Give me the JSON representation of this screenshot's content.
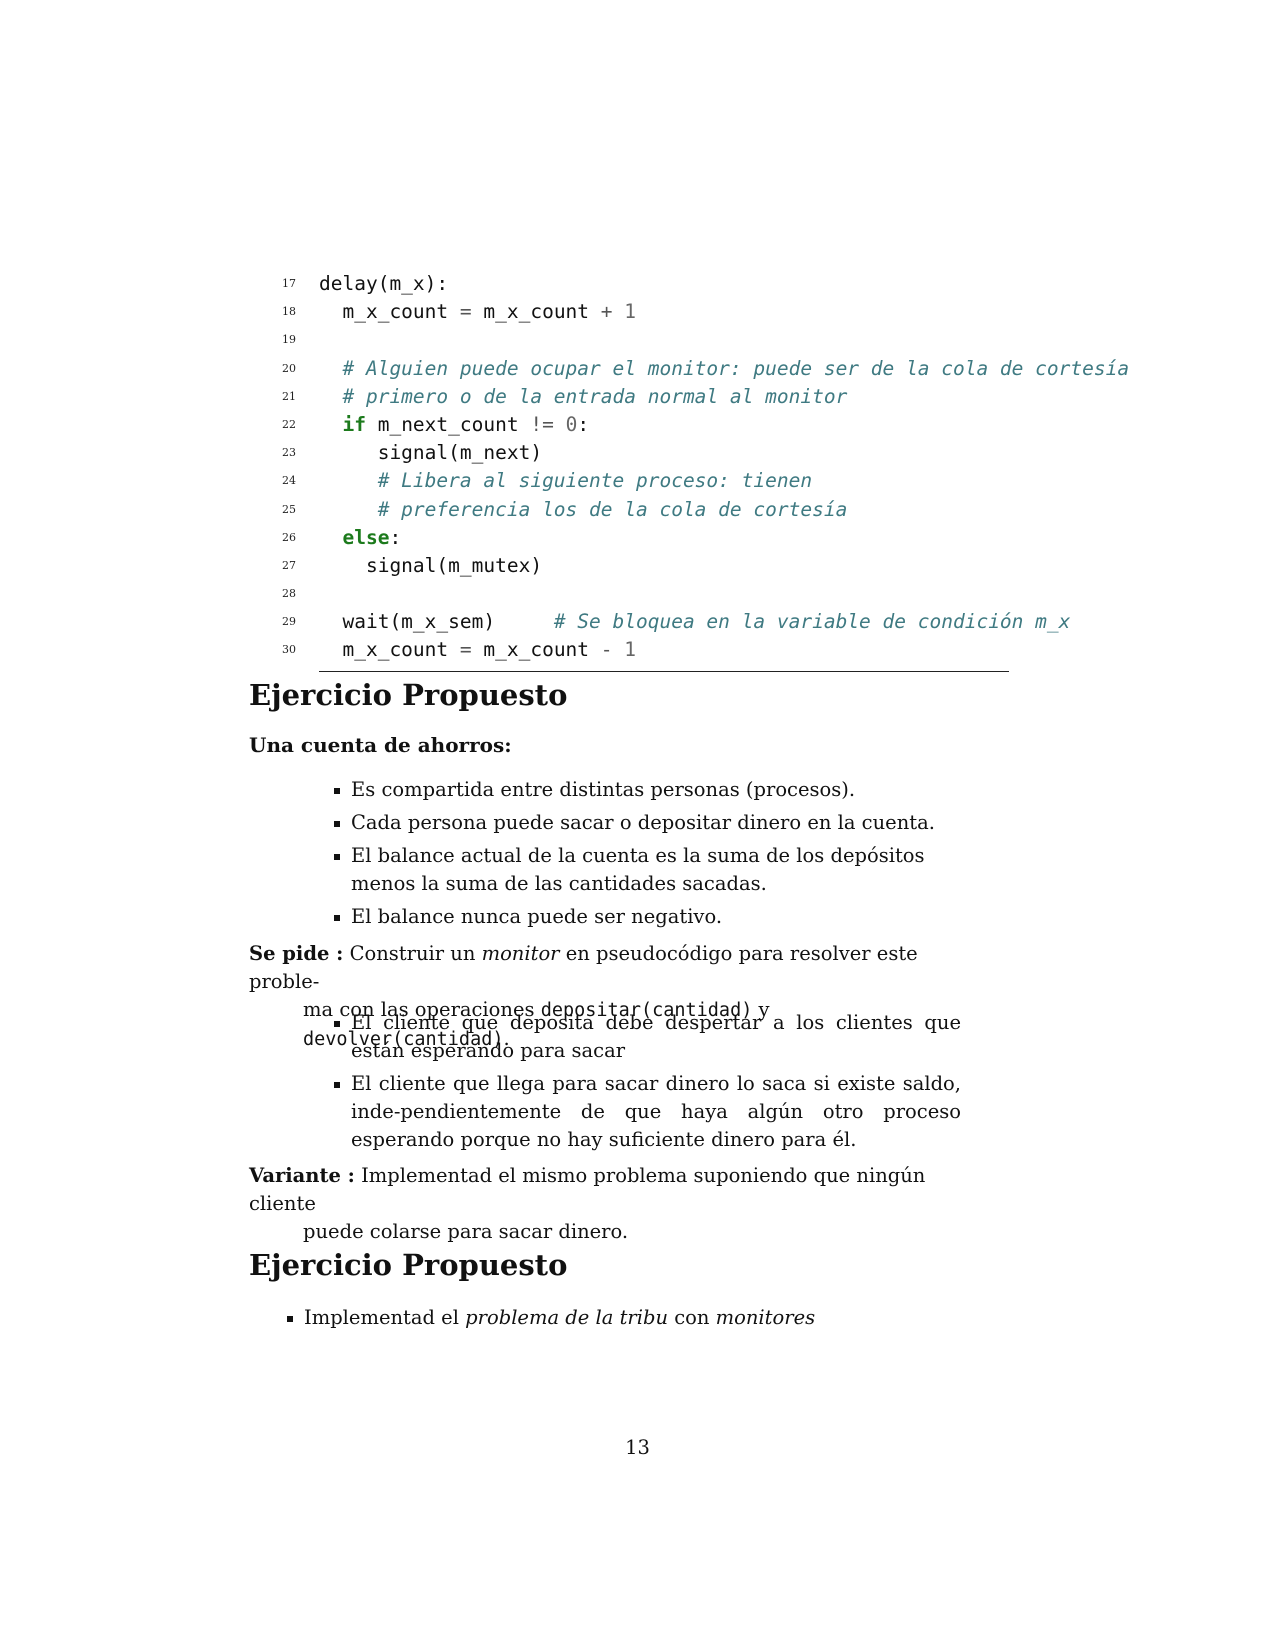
{
  "code": {
    "lines": [
      {
        "n": "17",
        "parts": [
          {
            "t": "delay(m_x):",
            "c": ""
          }
        ]
      },
      {
        "n": "18",
        "parts": [
          {
            "t": "  m_x_count ",
            "c": ""
          },
          {
            "t": "=",
            "c": "op"
          },
          {
            "t": " m_x_count ",
            "c": ""
          },
          {
            "t": "+",
            "c": "op"
          },
          {
            "t": " ",
            "c": ""
          },
          {
            "t": "1",
            "c": "num"
          }
        ]
      },
      {
        "n": "19",
        "parts": []
      },
      {
        "n": "20",
        "parts": [
          {
            "t": "  ",
            "c": ""
          },
          {
            "t": "# Alguien puede ocupar el monitor: puede ser de la cola de cortesía",
            "c": "cm"
          }
        ]
      },
      {
        "n": "21",
        "parts": [
          {
            "t": "  ",
            "c": ""
          },
          {
            "t": "# primero o de la entrada normal al monitor",
            "c": "cm"
          }
        ]
      },
      {
        "n": "22",
        "parts": [
          {
            "t": "  ",
            "c": ""
          },
          {
            "t": "if",
            "c": "kw"
          },
          {
            "t": " m_next_count ",
            "c": ""
          },
          {
            "t": "!=",
            "c": "op"
          },
          {
            "t": " ",
            "c": ""
          },
          {
            "t": "0",
            "c": "num"
          },
          {
            "t": ":",
            "c": ""
          }
        ]
      },
      {
        "n": "23",
        "parts": [
          {
            "t": "     signal(m_next)",
            "c": ""
          }
        ]
      },
      {
        "n": "24",
        "parts": [
          {
            "t": "     ",
            "c": ""
          },
          {
            "t": "# Libera al siguiente proceso: tienen",
            "c": "cm"
          }
        ]
      },
      {
        "n": "25",
        "parts": [
          {
            "t": "     ",
            "c": ""
          },
          {
            "t": "# preferencia los de la cola de cortesía",
            "c": "cm"
          }
        ]
      },
      {
        "n": "26",
        "parts": [
          {
            "t": "  ",
            "c": ""
          },
          {
            "t": "else",
            "c": "kw"
          },
          {
            "t": ":",
            "c": ""
          }
        ]
      },
      {
        "n": "27",
        "parts": [
          {
            "t": "    signal(m_mutex)",
            "c": ""
          }
        ]
      },
      {
        "n": "28",
        "parts": []
      },
      {
        "n": "29",
        "parts": [
          {
            "t": "  wait(m_x_sem)     ",
            "c": ""
          },
          {
            "t": "# Se bloquea en la variable de condición m_x",
            "c": "cm"
          }
        ]
      },
      {
        "n": "30",
        "parts": [
          {
            "t": "  m_x_count ",
            "c": ""
          },
          {
            "t": "=",
            "c": "op"
          },
          {
            "t": " m_x_count ",
            "c": ""
          },
          {
            "t": "-",
            "c": "op"
          },
          {
            "t": " ",
            "c": ""
          },
          {
            "t": "1",
            "c": "num"
          }
        ]
      }
    ]
  },
  "section1": {
    "title": "Ejercicio Propuesto",
    "subtitle": "Una cuenta de ahorros:",
    "bullets": [
      "Es compartida entre distintas personas (procesos).",
      "Cada persona puede sacar o depositar dinero en la cuenta.",
      "El balance actual de la cuenta es la suma de los depósitos menos la suma de las cantidades sacadas.",
      "El balance nunca puede ser negativo."
    ],
    "se_pide": {
      "term": "Se pide :",
      "t1": "Construir un ",
      "t2": "monitor",
      "t3": " en pseudocódigo para resolver este proble-",
      "t4": "ma con las operaciones ",
      "t5": "depositar(cantidad)",
      "t6": " y ",
      "t7": "devolver(cantidad)",
      "t8": "."
    },
    "bullets2": [
      "El cliente que deposita debe despertar a los clientes que están esperando para sacar",
      "El cliente que llega para sacar dinero lo saca si existe saldo, inde-pendientemente de que haya algún otro proceso esperando porque no hay suficiente dinero para él."
    ],
    "variante": {
      "term": "Variante :",
      "t1": "Implementad el mismo problema suponiendo que ningún cliente",
      "t2": "puede colarse para sacar dinero."
    }
  },
  "section2": {
    "title": "Ejercicio Propuesto",
    "item": {
      "t1": "Implementad el ",
      "t2": "problema de la tribu",
      "t3": " con ",
      "t4": "monitores"
    }
  },
  "page_number": "13"
}
